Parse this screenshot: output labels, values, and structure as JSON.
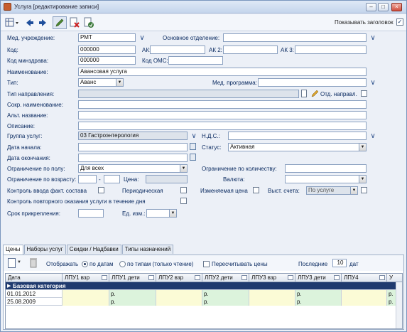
{
  "window": {
    "title": "Услуга [редактирование записи]"
  },
  "toolbar": {
    "show_header_label": "Показывать заголовок"
  },
  "form": {
    "med_org_label": "Мед. учреждение:",
    "med_org_value": "РМТ",
    "main_dept_label": "Основное отделение:",
    "code_label": "Код:",
    "code_value": "000000",
    "ak_label": "АК:",
    "ak2_label": "АК 2:",
    "ak3_label": "АК 3:",
    "mz_code_label": "Код минздрава:",
    "mz_code_value": "000000",
    "oms_code_label": "Код ОМС:",
    "name_label": "Наименование:",
    "name_value": "Авансовая услуга",
    "type_label": "Тип:",
    "type_value": "Аванс",
    "med_program_label": "Мед. программа:",
    "referral_type_label": "Тип направления:",
    "referral_checkbox_label": "Отд. направл.",
    "short_name_label": "Сокр. наименование:",
    "alt_name_label": "Альт. название:",
    "description_label": "Описание:",
    "group_label": "Группа услуг:",
    "group_value": "03 Гастроэнтерология",
    "vat_label": "Н.Д.С.:",
    "start_date_label": "Дата начала:",
    "status_label": "Статус:",
    "status_value": "Активная",
    "end_date_label": "Дата окончания:",
    "sex_limit_label": "Ограничение по полу:",
    "sex_limit_value": "Для всех",
    "qty_limit_label": "Ограничение по количеству:",
    "age_limit_label": "Ограничение по возрасту:",
    "age_dash": "-",
    "price_label": "Цена:",
    "currency_label": "Валюта:",
    "fact_control_label": "Контроль ввода факт. состава",
    "periodic_label": "Периодическая",
    "variable_price_label": "Изменяемая цена",
    "invoice_label": "Выст. счета:",
    "invoice_value": "По услуге",
    "repeat_control_label": "Контроль повторного оказания услуги в течение дня",
    "attach_term_label": "Срок прикрепления:",
    "unit_label": "Ед. изм.:"
  },
  "tabs": [
    "Цены",
    "Наборы услуг",
    "Скидки / Надбавки",
    "Типы назначений"
  ],
  "grid_toolbar": {
    "display_label": "Отображать",
    "by_dates_label": "по датам",
    "by_types_label": "по типам (только чтение)",
    "recalc_label": "Пересчитывать цены",
    "last_label": "Последние",
    "last_value": "10",
    "days_label": "дат"
  },
  "grid": {
    "headers": [
      "Дата",
      "ЛПУ1 взр",
      "ЛПУ1 дети",
      "ЛПУ2 взр",
      "ЛПУ2 дети",
      "ЛПУ3 взр",
      "ЛПУ3 дети",
      "ЛПУ4",
      "У"
    ],
    "group_row": "Базовая категория",
    "rows": [
      {
        "date": "01.01.2012",
        "cells": [
          "",
          "р.",
          "",
          "р.",
          "",
          "р.",
          "",
          "р.",
          ""
        ]
      },
      {
        "date": "25.08.2009",
        "cells": [
          "",
          "р.",
          "",
          "р.",
          "",
          "р.",
          "",
          "р.",
          ""
        ]
      }
    ]
  },
  "colors": {
    "accent": "#0a2a60",
    "group_row_bg": "#1f3a6e",
    "cell_yellow": "#fbfbd6",
    "cell_green": "#dcf3dc"
  }
}
